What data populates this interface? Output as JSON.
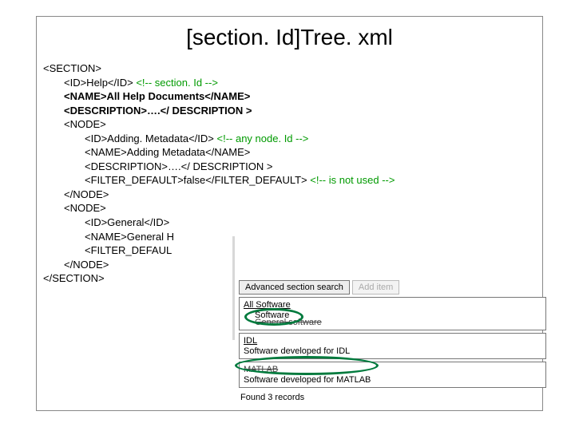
{
  "title": "[section. Id]Tree. xml",
  "xml": {
    "l1": "<SECTION>",
    "l2a": "<ID>Help</ID> ",
    "l2b": "<!-- section. Id -->",
    "l3": "<NAME>All Help Documents</NAME>",
    "l4": "<DESCRIPTION>….</ DESCRIPTION >",
    "l5": "<NODE>",
    "l6a": "<ID>Adding. Metadata</ID> ",
    "l6b": "<!-- any node. Id -->",
    "l7": "<NAME>Adding Metadata</NAME>",
    "l8": "<DESCRIPTION>….</ DESCRIPTION >",
    "l9a": "<FILTER_DEFAULT>false</FILTER_DEFAULT> ",
    "l9b": "<!-- is not used -->",
    "l10": "</NODE>",
    "l11": "<NODE>",
    "l12": "<ID>General</ID>",
    "l13": "<NAME>General H",
    "l14": "<FILTER_DEFAUL",
    "l15": "</NODE>",
    "l16": "</SECTION>"
  },
  "panel": {
    "tab1": "Advanced section search",
    "tab2": "Add item",
    "item1": {
      "title": "All Software",
      "sub_a": "Software",
      "sub_b": "General software"
    },
    "item2": {
      "title": "IDL",
      "sub": "Software developed for IDL"
    },
    "item3": {
      "title": "MATLAB",
      "sub": "Software developed for MATLAB"
    },
    "status": "Found 3 records"
  }
}
